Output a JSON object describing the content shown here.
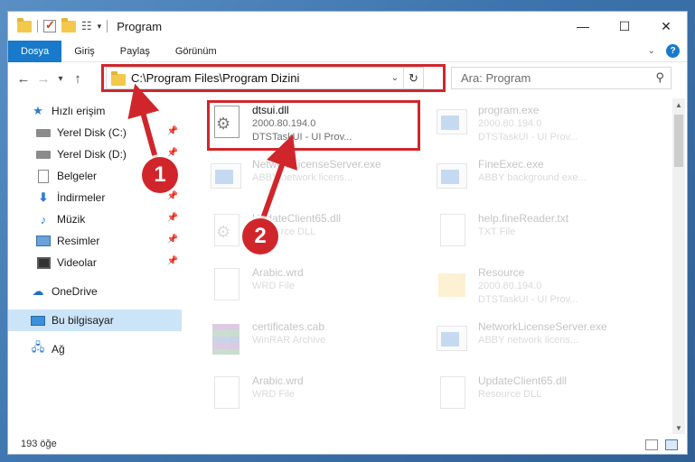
{
  "window": {
    "title": "Program"
  },
  "ribbon": {
    "tabs": [
      {
        "label": "Dosya"
      },
      {
        "label": "Giriş"
      },
      {
        "label": "Paylaş"
      },
      {
        "label": "Görünüm"
      }
    ]
  },
  "address": {
    "path": "C:\\Program Files\\Program Dizini"
  },
  "search": {
    "placeholder": "Ara: Program"
  },
  "sidebar": {
    "items": [
      {
        "label": "Hızlı erişim",
        "icon": "star-icon"
      },
      {
        "label": "Yerel Disk (C:)",
        "icon": "disk-icon",
        "pinned": true
      },
      {
        "label": "Yerel Disk (D:)",
        "icon": "disk-icon",
        "pinned": true
      },
      {
        "label": "Belgeler",
        "icon": "document-icon",
        "pinned": true
      },
      {
        "label": "İndirmeler",
        "icon": "download-icon",
        "pinned": true
      },
      {
        "label": "Müzik",
        "icon": "music-icon",
        "pinned": true
      },
      {
        "label": "Resimler",
        "icon": "picture-icon",
        "pinned": true
      },
      {
        "label": "Videolar",
        "icon": "video-icon",
        "pinned": true
      },
      {
        "label": "OneDrive",
        "icon": "cloud-icon"
      },
      {
        "label": "Bu bilgisayar",
        "icon": "computer-icon",
        "selected": true
      },
      {
        "label": "Ağ",
        "icon": "network-icon"
      }
    ]
  },
  "files": [
    {
      "name": "dtsui.dll",
      "line2": "2000.80.194.0",
      "line3": "DTSTaskUI - UI Prov...",
      "icon": "dll-icon",
      "highlighted": true
    },
    {
      "name": "program.exe",
      "line2": "2000.80.194.0",
      "line3": "DTSTaskUI - UI Prov...",
      "icon": "exe-icon"
    },
    {
      "name": "NetworkLicenseServer.exe",
      "line2": "ABBY network licens...",
      "line3": "",
      "icon": "exe-icon"
    },
    {
      "name": "FineExec.exe",
      "line2": "ABBY background exe...",
      "line3": "",
      "icon": "exe-icon"
    },
    {
      "name": "UpdateClient65.dll",
      "line2": "Resource DLL",
      "line3": "",
      "icon": "dll-icon"
    },
    {
      "name": "help.fineReader.txt",
      "line2": "TXT File",
      "line3": "",
      "icon": "text-file-icon"
    },
    {
      "name": "Arabic.wrd",
      "line2": "WRD File",
      "line3": "",
      "icon": "file-icon"
    },
    {
      "name": "Resource",
      "line2": "2000.80.194.0",
      "line3": "DTSTaskUI - UI Prov...",
      "icon": "folder-icon"
    },
    {
      "name": "certificates.cab",
      "line2": "WinRAR Archive",
      "line3": "",
      "icon": "archive-icon"
    },
    {
      "name": "NetworkLicenseServer.exe",
      "line2": "ABBY network licens...",
      "line3": "",
      "icon": "exe-icon"
    },
    {
      "name": "Arabic.wrd",
      "line2": "WRD File",
      "line3": "",
      "icon": "file-icon"
    },
    {
      "name": "UpdateClient65.dll",
      "line2": "Resource DLL",
      "line3": "",
      "icon": "dll-icon"
    }
  ],
  "status": {
    "item_count": "193 öğe"
  },
  "annotations": {
    "step1": "1",
    "step2": "2",
    "color": "#d0262b"
  },
  "colors": {
    "accent": "#1979ca",
    "selected_bg": "#cce4f7"
  }
}
